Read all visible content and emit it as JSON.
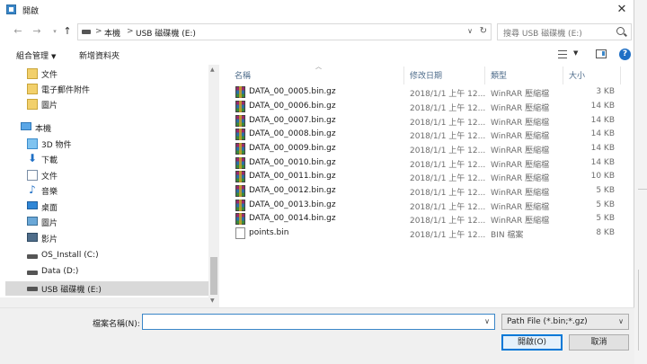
{
  "window": {
    "title": "開啟"
  },
  "address": {
    "segments": [
      "本機",
      "USB 磁碟機 (E:)"
    ],
    "separator": ">"
  },
  "search": {
    "placeholder": "搜尋 USB 磁碟機 (E:)"
  },
  "toolbar": {
    "organize": "組合管理",
    "new_folder": "新增資料夾"
  },
  "nav": {
    "items": [
      {
        "label": "文件",
        "icon": "quick-access-documents-icon"
      },
      {
        "label": "電子郵件附件",
        "icon": "email-attachments-folder-icon"
      },
      {
        "label": "圖片",
        "icon": "quick-access-pictures-icon"
      },
      {
        "label": "本機",
        "icon": "this-pc-icon"
      },
      {
        "label": "3D 物件",
        "icon": "3d-objects-icon"
      },
      {
        "label": "下載",
        "icon": "downloads-icon"
      },
      {
        "label": "文件",
        "icon": "documents-icon"
      },
      {
        "label": "音樂",
        "icon": "music-icon"
      },
      {
        "label": "桌面",
        "icon": "desktop-icon"
      },
      {
        "label": "圖片",
        "icon": "pictures-icon"
      },
      {
        "label": "影片",
        "icon": "videos-icon"
      },
      {
        "label": "OS_Install (C:)",
        "icon": "drive-c-icon"
      },
      {
        "label": "Data (D:)",
        "icon": "drive-d-icon"
      },
      {
        "label": "USB 磁碟機 (E:)",
        "icon": "usb-drive-icon",
        "selected": true
      }
    ]
  },
  "columns": {
    "name": "名稱",
    "date": "修改日期",
    "type": "類型",
    "size": "大小"
  },
  "files": [
    {
      "name": "DATA_00_0005.bin.gz",
      "date": "2018/1/1 上午 12...",
      "type": "WinRAR 壓縮檔",
      "size": "3 KB",
      "icon": "winrar-archive-icon"
    },
    {
      "name": "DATA_00_0006.bin.gz",
      "date": "2018/1/1 上午 12...",
      "type": "WinRAR 壓縮檔",
      "size": "14 KB",
      "icon": "winrar-archive-icon"
    },
    {
      "name": "DATA_00_0007.bin.gz",
      "date": "2018/1/1 上午 12...",
      "type": "WinRAR 壓縮檔",
      "size": "14 KB",
      "icon": "winrar-archive-icon"
    },
    {
      "name": "DATA_00_0008.bin.gz",
      "date": "2018/1/1 上午 12...",
      "type": "WinRAR 壓縮檔",
      "size": "14 KB",
      "icon": "winrar-archive-icon"
    },
    {
      "name": "DATA_00_0009.bin.gz",
      "date": "2018/1/1 上午 12...",
      "type": "WinRAR 壓縮檔",
      "size": "14 KB",
      "icon": "winrar-archive-icon"
    },
    {
      "name": "DATA_00_0010.bin.gz",
      "date": "2018/1/1 上午 12...",
      "type": "WinRAR 壓縮檔",
      "size": "14 KB",
      "icon": "winrar-archive-icon"
    },
    {
      "name": "DATA_00_0011.bin.gz",
      "date": "2018/1/1 上午 12...",
      "type": "WinRAR 壓縮檔",
      "size": "10 KB",
      "icon": "winrar-archive-icon"
    },
    {
      "name": "DATA_00_0012.bin.gz",
      "date": "2018/1/1 上午 12...",
      "type": "WinRAR 壓縮檔",
      "size": "5 KB",
      "icon": "winrar-archive-icon"
    },
    {
      "name": "DATA_00_0013.bin.gz",
      "date": "2018/1/1 上午 12...",
      "type": "WinRAR 壓縮檔",
      "size": "5 KB",
      "icon": "winrar-archive-icon"
    },
    {
      "name": "DATA_00_0014.bin.gz",
      "date": "2018/1/1 上午 12...",
      "type": "WinRAR 壓縮檔",
      "size": "5 KB",
      "icon": "winrar-archive-icon"
    },
    {
      "name": "points.bin",
      "date": "2018/1/1 上午 12...",
      "type": "BIN 檔案",
      "size": "8 KB",
      "icon": "generic-file-icon"
    }
  ],
  "footer": {
    "filename_label": "檔案名稱(N):",
    "filename_value": "",
    "filetype_value": "Path File (*.bin;*.gz)",
    "open_label": "開啟(O)",
    "cancel_label": "取消"
  },
  "colors": {
    "accent": "#0078d7",
    "selection": "#d9d9d9",
    "header_text": "#4d6b8a"
  }
}
